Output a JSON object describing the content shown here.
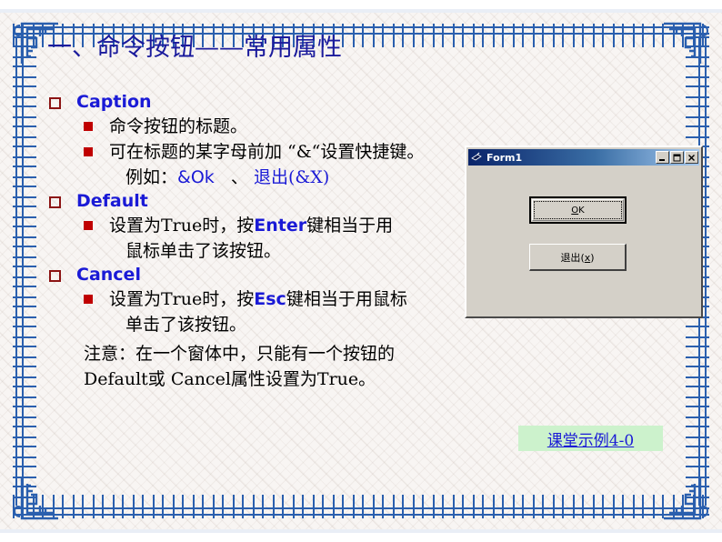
{
  "slide": {
    "title": "一、命令按钮——常用属性",
    "background_color": "#f8f5f3",
    "frame_color": "#2a5fae",
    "title_color": "#1a1a9c"
  },
  "content": {
    "sections": [
      {
        "heading": "Caption",
        "bullets": [
          "命令按钮的标题。",
          "可在标题的某字母前加 “&“设置快捷键。"
        ],
        "continuation": "例如：&Ok  、 退出(&X)"
      },
      {
        "heading": "Default",
        "bullets_rich": {
          "pre": "设置为True时，按",
          "key": "Enter",
          "post": "键相当于用"
        },
        "continuation": "鼠标单击了该按钮。"
      },
      {
        "heading": "Cancel",
        "bullets_rich": {
          "pre": "设置为True时，按",
          "key": "Esc",
          "post": "键相当于用鼠标"
        },
        "continuation": "单击了该按钮。"
      }
    ],
    "note": {
      "line1": "注意：在一个窗体中，只能有一个按钮的",
      "line2": "Default或 Cancel属性设置为True。"
    }
  },
  "vb_form": {
    "title": "Form1",
    "icon": "vb-form-icon",
    "window_buttons": [
      {
        "name": "minimize",
        "glyph": "minimize-icon"
      },
      {
        "name": "maximize",
        "glyph": "maximize-icon"
      },
      {
        "name": "close",
        "glyph": "close-icon"
      }
    ],
    "buttons": [
      {
        "name": "ok",
        "label_accel": "O",
        "label_rest": "K",
        "is_default": true,
        "focused": true
      },
      {
        "name": "exit",
        "label_text": "退出",
        "label_accel": "x",
        "is_default": false,
        "focused": false
      }
    ],
    "colors": {
      "face": "#d4d0c8",
      "titlebar_start": "#0a246a",
      "titlebar_end": "#a6caf0"
    }
  },
  "example_box": {
    "label": "课堂示例4-0",
    "background_color": "#ccf2cc",
    "text_color": "#1a1ad6"
  }
}
